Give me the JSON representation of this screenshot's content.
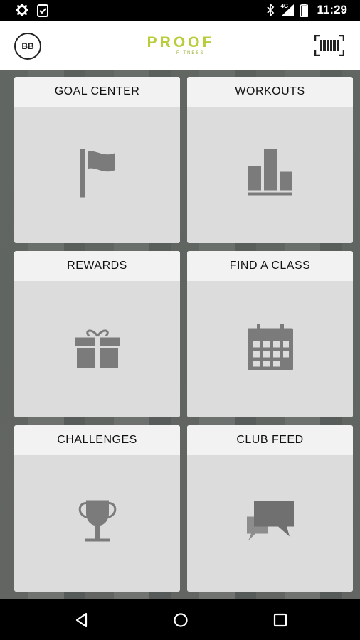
{
  "status_bar": {
    "time": "11:29",
    "network": "4G",
    "icons": [
      "gear-icon",
      "clipboard-check-icon",
      "bluetooth-icon",
      "signal-icon",
      "battery-icon"
    ]
  },
  "header": {
    "avatar_initials": "BB",
    "logo_main": "PROOF",
    "logo_sub": "FITNESS",
    "barcode_icon": "barcode-icon",
    "brand_color": "#b9cd3a"
  },
  "tiles": [
    {
      "label": "GOAL CENTER",
      "icon": "flag-icon"
    },
    {
      "label": "WORKOUTS",
      "icon": "bar-chart-icon"
    },
    {
      "label": "REWARDS",
      "icon": "gift-icon"
    },
    {
      "label": "FIND A CLASS",
      "icon": "calendar-icon"
    },
    {
      "label": "CHALLENGES",
      "icon": "trophy-icon"
    },
    {
      "label": "CLUB FEED",
      "icon": "chat-bubbles-icon"
    }
  ],
  "nav": {
    "icons": [
      "back-icon",
      "home-icon",
      "recents-icon"
    ]
  }
}
